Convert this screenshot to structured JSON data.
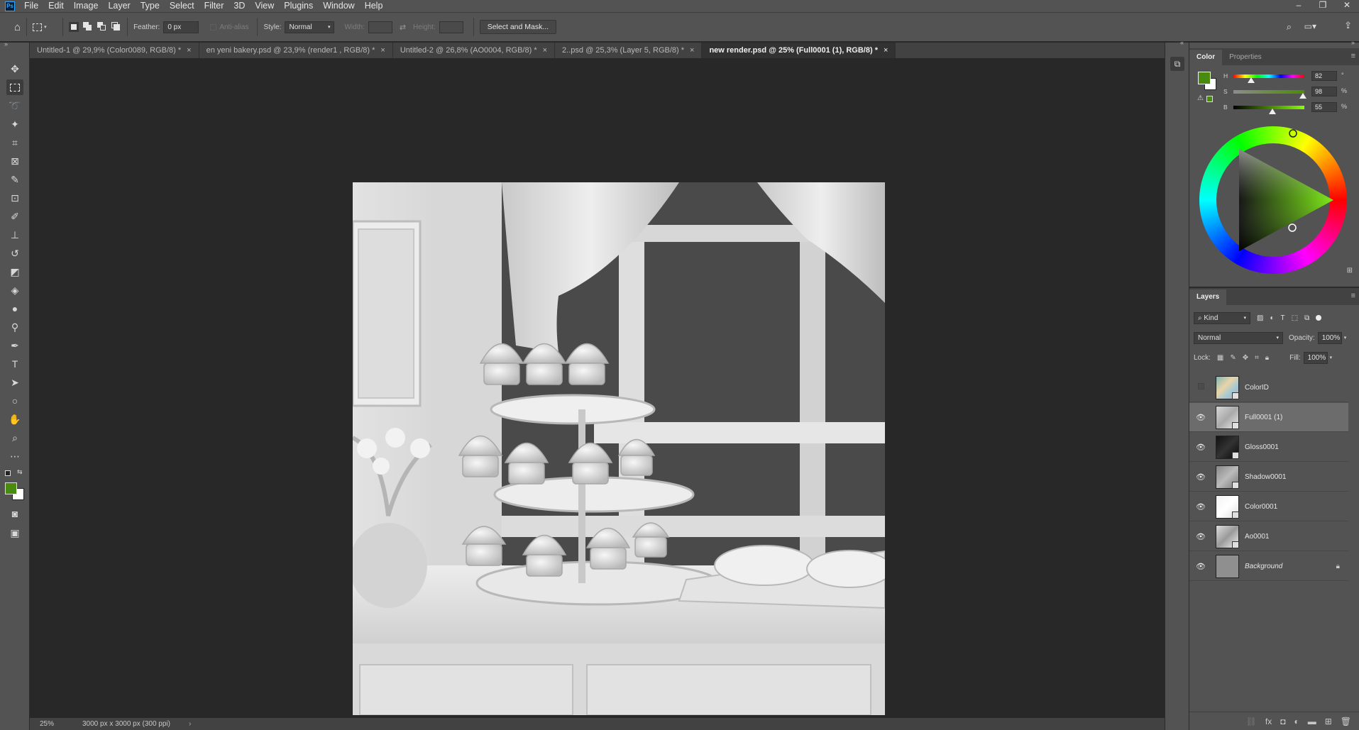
{
  "app": {
    "logo_text": "Ps"
  },
  "menu": [
    "File",
    "Edit",
    "Image",
    "Layer",
    "Type",
    "Select",
    "Filter",
    "3D",
    "View",
    "Plugins",
    "Window",
    "Help"
  ],
  "options_bar": {
    "feather_label": "Feather:",
    "feather_value": "0 px",
    "antialias_label": "Anti-alias",
    "style_label": "Style:",
    "style_value": "Normal",
    "width_label": "Width:",
    "height_label": "Height:",
    "select_mask_label": "Select and Mask..."
  },
  "tabs": [
    {
      "label": "Untitled-1 @ 29,9% (Color0089, RGB/8) *",
      "active": false
    },
    {
      "label": "en yeni bakery.psd @ 23,9% (render1 , RGB/8) *",
      "active": false
    },
    {
      "label": "Untitled-2 @ 26,8% (AO0004, RGB/8) *",
      "active": false
    },
    {
      "label": "2..psd @ 25,3% (Layer 5, RGB/8) *",
      "active": false
    },
    {
      "label": "new render.psd @ 25% (Full0001 (1), RGB/8) *",
      "active": true
    }
  ],
  "status": {
    "zoom": "25%",
    "doc_info": "3000 px x 3000 px (300 ppi)"
  },
  "color_panel": {
    "tab_color": "Color",
    "tab_properties": "Properties",
    "foreground": "#4a8a0e",
    "background": "#ffffff",
    "h_label": "H",
    "h_value": "82",
    "h_unit": "°",
    "s_label": "S",
    "s_value": "98",
    "s_unit": "%",
    "b_label": "B",
    "b_value": "55",
    "b_unit": "%"
  },
  "layers_panel": {
    "title": "Layers",
    "filter_kind": "Kind",
    "blend_mode": "Normal",
    "opacity_label": "Opacity:",
    "opacity_value": "100%",
    "lock_label": "Lock:",
    "fill_label": "Fill:",
    "fill_value": "100%",
    "layers": [
      {
        "name": "ColorID",
        "visible": false,
        "selected": false
      },
      {
        "name": "Full0001 (1)",
        "visible": true,
        "selected": true
      },
      {
        "name": "Gloss0001",
        "visible": true,
        "selected": false
      },
      {
        "name": "Shadow0001",
        "visible": true,
        "selected": false
      },
      {
        "name": "Color0001",
        "visible": true,
        "selected": false
      },
      {
        "name": "Ao0001",
        "visible": true,
        "selected": false
      },
      {
        "name": "Background",
        "visible": true,
        "selected": false,
        "locked": true
      }
    ]
  }
}
